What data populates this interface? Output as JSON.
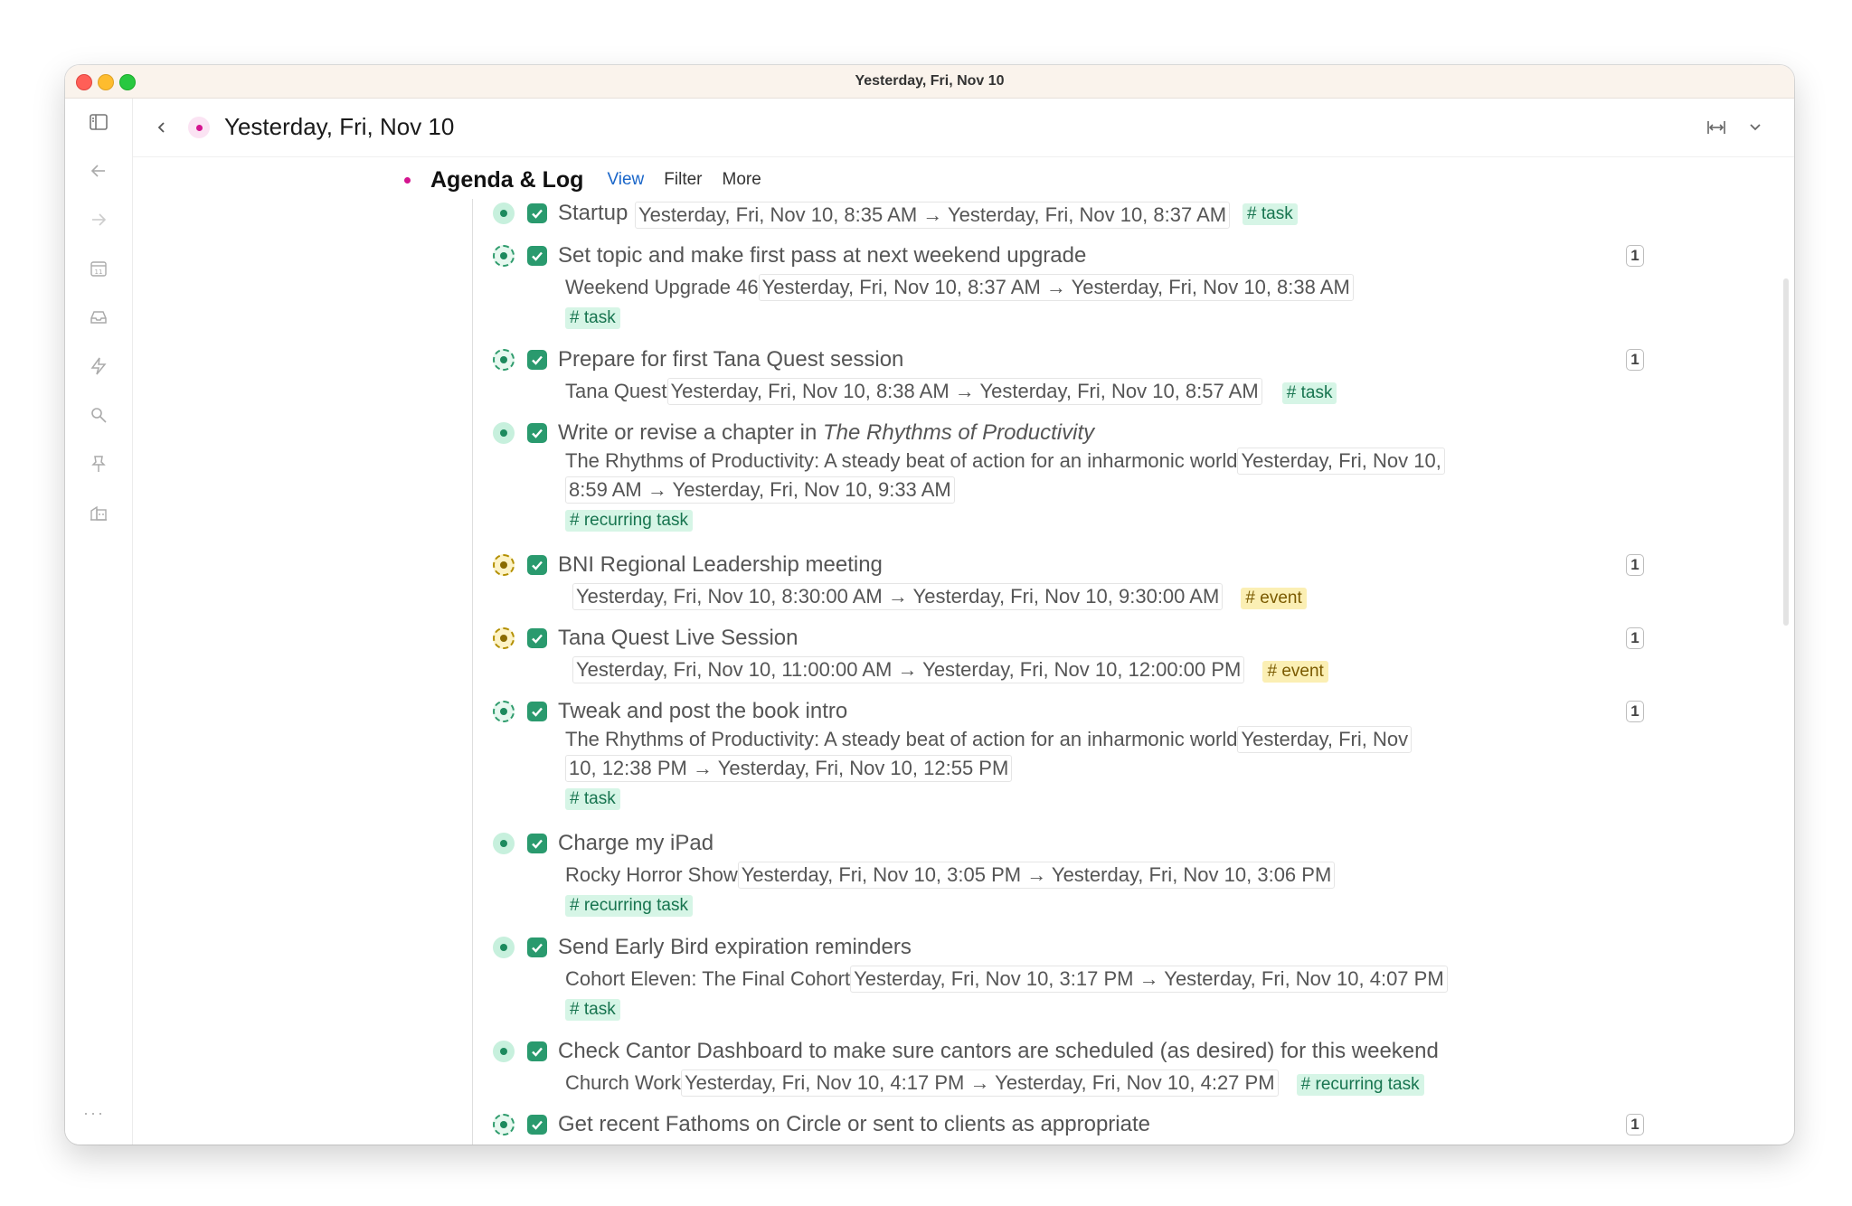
{
  "window": {
    "title": "Yesterday, Fri, Nov 10"
  },
  "header": {
    "title": "Yesterday, Fri, Nov 10"
  },
  "sidebar": {
    "icons": [
      "sidebar-toggle-icon",
      "arrow-left-icon",
      "arrow-right-icon",
      "calendar-icon",
      "inbox-icon",
      "lightning-icon",
      "search-icon",
      "pin-icon",
      "workspace-icon"
    ],
    "calendar_day": "11",
    "more": "···"
  },
  "agenda": {
    "title": "Agenda & Log",
    "view": "View",
    "filter": "Filter",
    "more": "More"
  },
  "colors": {
    "accent_pink": "#d4148f",
    "task_green": "#2a9a6e",
    "tag_green_bg": "#d6f5e6",
    "tag_yellow_bg": "#fbefb4",
    "link_blue": "#1a66c9"
  },
  "items": [
    {
      "title": "Startup",
      "dates": "Yesterday, Fri, Nov 10, 8:35 AM → Yesterday, Fri, Nov 10, 8:37 AM",
      "tag": "# task"
    },
    {
      "title": "Set topic and make first pass at next weekend upgrade",
      "ref": "Weekend Upgrade 46",
      "dates": "Yesterday, Fri, Nov 10, 8:37 AM → Yesterday, Fri, Nov 10, 8:38 AM",
      "tag": "# task",
      "count": "1"
    },
    {
      "title": "Prepare for first Tana Quest session",
      "ref": "Tana Quest",
      "dates": "Yesterday, Fri, Nov 10, 8:38 AM → Yesterday, Fri, Nov 10, 8:57 AM",
      "tag": "# task",
      "count": "1"
    },
    {
      "title_prefix": "Write or revise a chapter in ",
      "title_italic": "The Rhythms of Productivity",
      "ref": "The Rhythms of Productivity: A steady beat of action for an inharmonic world",
      "dates_a": "Yesterday, Fri, Nov 10,",
      "dates_b": "8:59 AM → Yesterday, Fri, Nov 10, 9:33 AM",
      "tag": "# recurring task"
    },
    {
      "title": "BNI Regional Leadership meeting",
      "dates": "Yesterday, Fri, Nov 10, 8:30:00 AM → Yesterday, Fri, Nov 10, 9:30:00 AM",
      "tag": "# event",
      "count": "1"
    },
    {
      "title": "Tana Quest Live Session",
      "dates": "Yesterday, Fri, Nov 10, 11:00:00 AM → Yesterday, Fri, Nov 10, 12:00:00 PM",
      "tag": "# event",
      "count": "1"
    },
    {
      "title": "Tweak and post the book intro",
      "ref": "The Rhythms of Productivity: A steady beat of action for an inharmonic world",
      "dates_a": "Yesterday, Fri, Nov",
      "dates_b": "10, 12:38 PM → Yesterday, Fri, Nov 10, 12:55 PM",
      "tag": "# task",
      "count": "1"
    },
    {
      "title": "Charge my iPad",
      "ref": "Rocky Horror Show",
      "dates": "Yesterday, Fri, Nov 10, 3:05 PM → Yesterday, Fri, Nov 10, 3:06 PM",
      "tag": "# recurring task"
    },
    {
      "title": "Send Early Bird expiration reminders",
      "ref": "Cohort Eleven: The Final Cohort",
      "dates": "Yesterday, Fri, Nov 10, 3:17 PM → Yesterday, Fri, Nov 10, 4:07 PM",
      "tag": "# task"
    },
    {
      "title": "Check Cantor Dashboard to make sure cantors are scheduled (as desired) for this weekend",
      "ref": "Church Work",
      "dates": "Yesterday, Fri, Nov 10, 4:17 PM → Yesterday, Fri, Nov 10, 4:27 PM",
      "tag": "# recurring task"
    },
    {
      "title": "Get recent Fathoms on Circle or sent to clients as appropriate",
      "count": "1"
    }
  ]
}
